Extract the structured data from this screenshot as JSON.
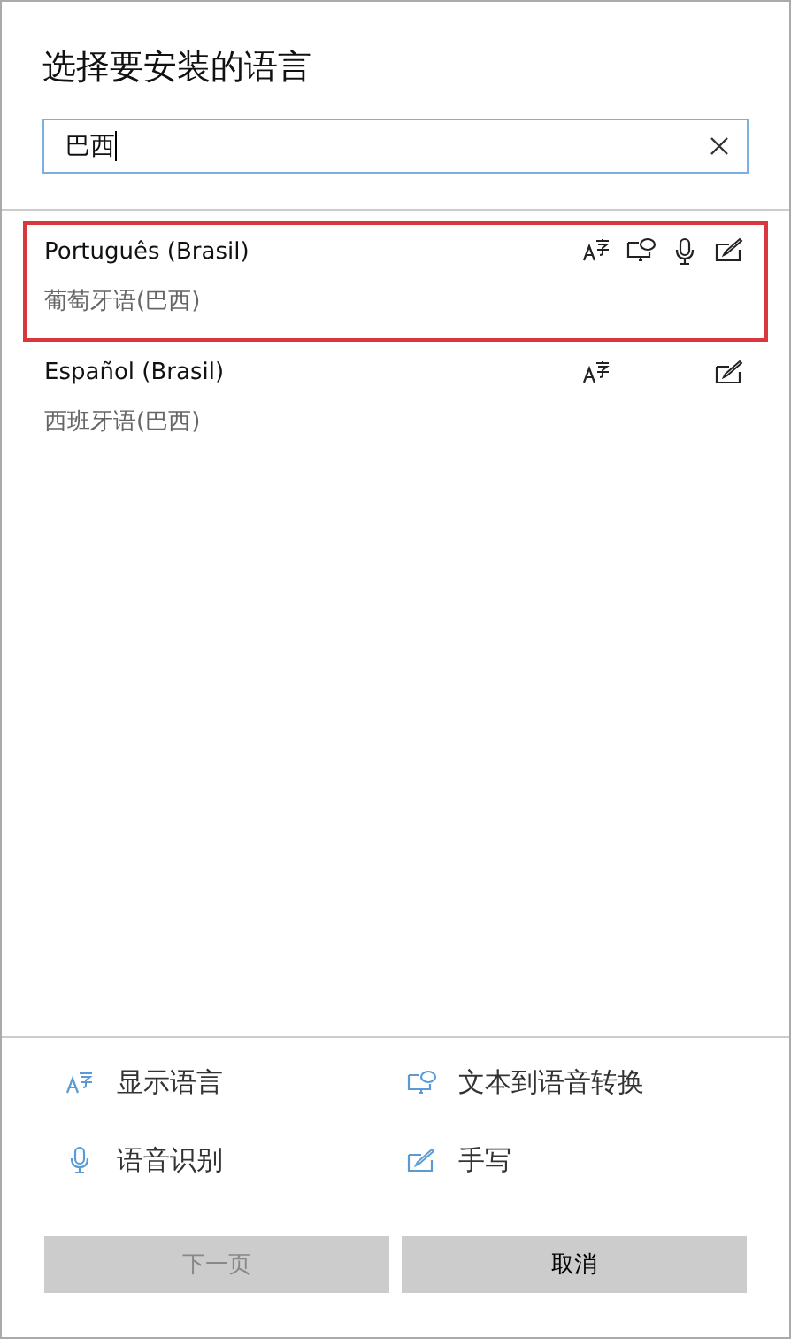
{
  "title": "选择要安装的语言",
  "search": {
    "value": "巴西"
  },
  "languages": [
    {
      "name": "Português (Brasil)",
      "native": "葡萄牙语(巴西)",
      "highlighted": true,
      "features": {
        "display": true,
        "tts": true,
        "speech": true,
        "handwriting": true
      }
    },
    {
      "name": "Español (Brasil)",
      "native": "西班牙语(巴西)",
      "highlighted": false,
      "features": {
        "display": true,
        "tts": false,
        "speech": false,
        "handwriting": true
      }
    }
  ],
  "legend": [
    {
      "kind": "display",
      "label": "显示语言"
    },
    {
      "kind": "tts",
      "label": "文本到语音转换"
    },
    {
      "kind": "speech",
      "label": "语音识别"
    },
    {
      "kind": "handwriting",
      "label": "手写"
    }
  ],
  "buttons": [
    {
      "label": "下一页",
      "disabled": true
    },
    {
      "label": "取消",
      "disabled": false
    }
  ]
}
